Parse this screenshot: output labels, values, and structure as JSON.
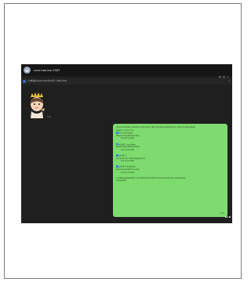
{
  "window": {
    "chat_title": "เอกสารสมาคม 2567"
  },
  "pinned": {
    "text": "รายชื่อผู้ส่งเอกสารเรียบร้อยแล้ว ( ติดตามต่อ)"
  },
  "sticker": {
    "time": "9:41"
  },
  "message": {
    "lines": [
      "แจ้งรายละเอียดการส่งเอกสารประกอบการพิจารณาของสมาชิกทุกท่าน กรุณาตรวจสอบข้อมูล",
      "ฉบับที่ 1 (ระยะแรก)",
      "ส่งภายในวันศุกร์",
      "ติดต่อเจ้าหน้าที่ฝ่ายทะเบียน",
      "ส่งทางไปรษณีย์",
      "ฉบับที่ 2 ระยะที่สอง",
      "ติดต่อเจ้าหน้าที่ฝ่ายทะเบียน",
      "ส่งทางไปรษณีย์",
      "ฉบับที่ 3",
      "หมายเหตุ: ตรวจสอบข้อมูลก่อนส่ง",
      "ส่งทางไปรษณีย์",
      "ฉบับที่ 4 ส่งเพิ่มเติม",
      "ติดต่อเจ้าหน้าที่ฝ่ายทะเบียน",
      "ส่งทางไปรษณีย์",
      "หากมีข้อสงสัยเพิ่มเติม กรุณาติดต่อเจ้าหน้าที่ฝ่ายทะเบียนของสมาคม ขอบคุณครับ",
      "ขอบคุณครับ"
    ],
    "time": "9:42"
  },
  "colors": {
    "app_bg": "#1f1f1f",
    "bubble": "#7edb6f",
    "accent": "#2f7de1"
  }
}
